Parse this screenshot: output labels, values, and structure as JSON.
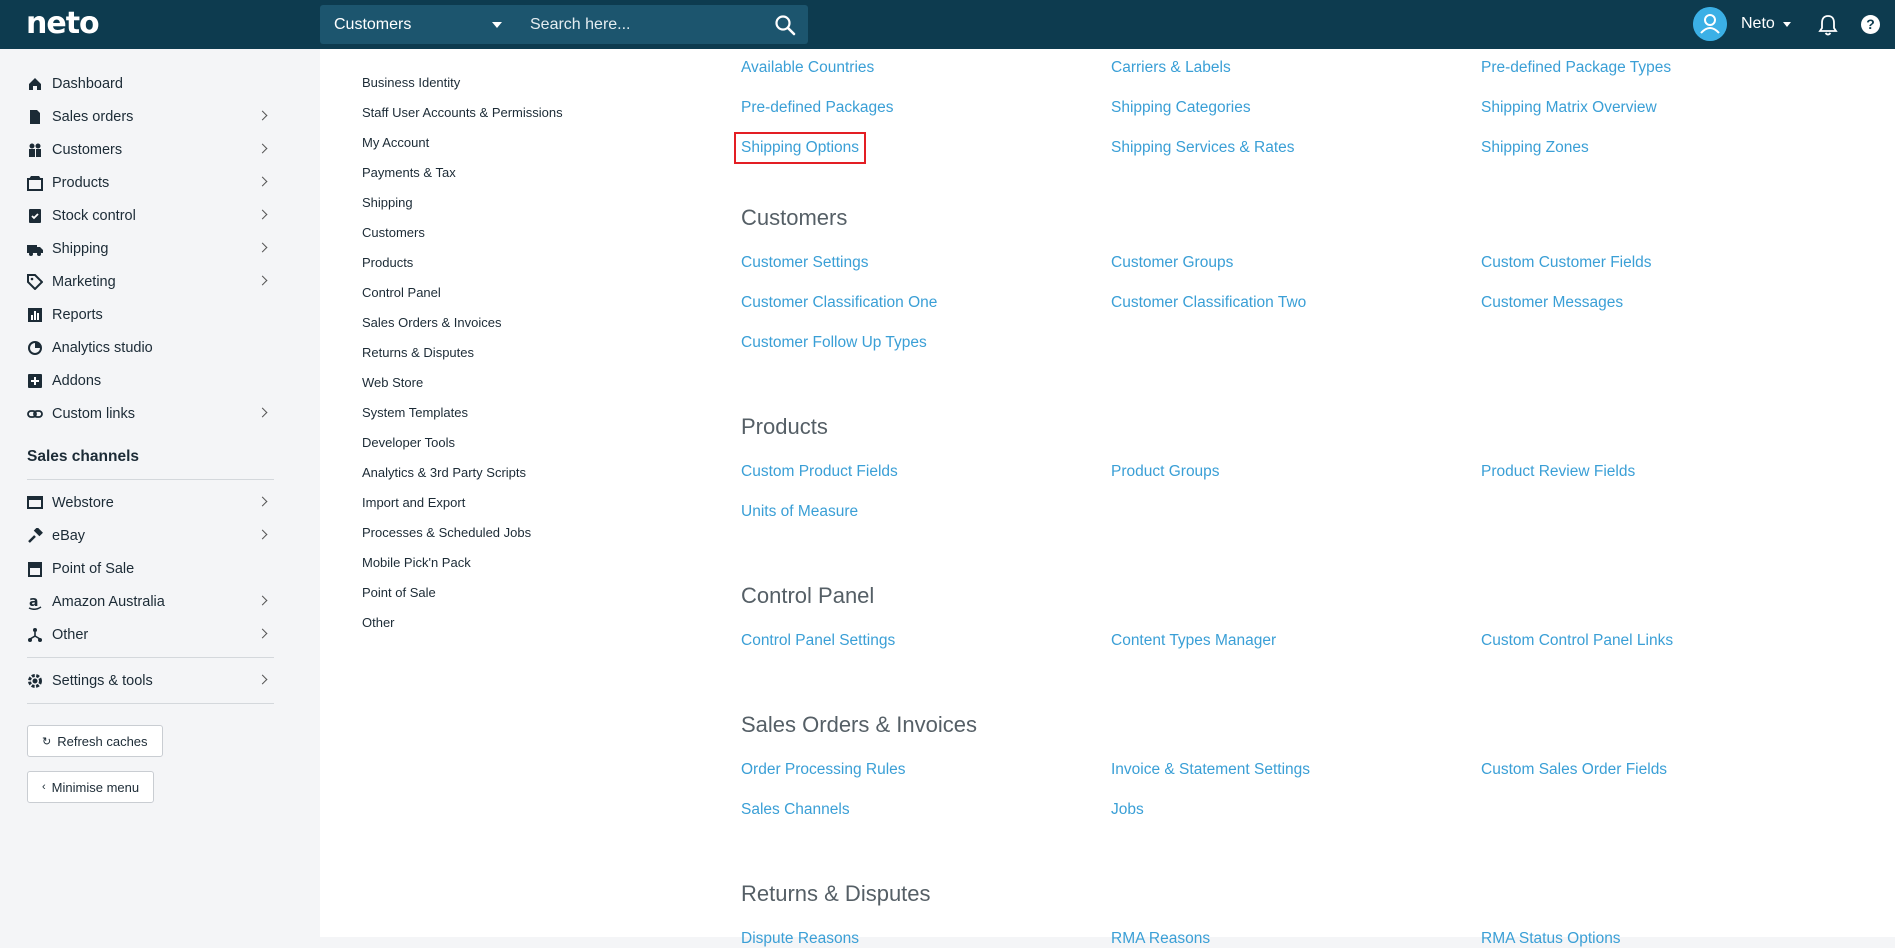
{
  "topbar": {
    "logo": "neto",
    "search_scope": "Customers",
    "search_placeholder": "Search here...",
    "user_name": "Neto",
    "help_label": "?"
  },
  "sidebar": {
    "items": [
      {
        "label": "Dashboard",
        "icon": "home-icon",
        "chevron": false
      },
      {
        "label": "Sales orders",
        "icon": "document-icon",
        "chevron": true
      },
      {
        "label": "Customers",
        "icon": "people-icon",
        "chevron": true
      },
      {
        "label": "Products",
        "icon": "box-icon",
        "chevron": true
      },
      {
        "label": "Stock control",
        "icon": "clipboard-check-icon",
        "chevron": true
      },
      {
        "label": "Shipping",
        "icon": "truck-icon",
        "chevron": true
      },
      {
        "label": "Marketing",
        "icon": "tag-icon",
        "chevron": true
      },
      {
        "label": "Reports",
        "icon": "bar-chart-icon",
        "chevron": false
      },
      {
        "label": "Analytics studio",
        "icon": "analytics-icon",
        "chevron": false
      },
      {
        "label": "Addons",
        "icon": "plus-square-icon",
        "chevron": false
      },
      {
        "label": "Custom links",
        "icon": "link-icon",
        "chevron": true
      }
    ],
    "channels_heading": "Sales channels",
    "channels": [
      {
        "label": "Webstore",
        "icon": "store-icon",
        "chevron": true
      },
      {
        "label": "eBay",
        "icon": "gavel-icon",
        "chevron": true
      },
      {
        "label": "Point of Sale",
        "icon": "shop-icon",
        "chevron": false
      },
      {
        "label": "Amazon Australia",
        "icon": "amazon-icon",
        "chevron": true
      },
      {
        "label": "Other",
        "icon": "network-icon",
        "chevron": true
      }
    ],
    "settings": {
      "label": "Settings & tools",
      "icon": "gear-icon"
    },
    "refresh_label": "Refresh caches",
    "minimise_label": "Minimise menu"
  },
  "subnav": [
    "Business Identity",
    "Staff User Accounts & Permissions",
    "My Account",
    "Payments & Tax",
    "Shipping",
    "Customers",
    "Products",
    "Control Panel",
    "Sales Orders & Invoices",
    "Returns & Disputes",
    "Web Store",
    "System Templates",
    "Developer Tools",
    "Analytics & 3rd Party Scripts",
    "Import and Export",
    "Processes & Scheduled Jobs",
    "Mobile Pick'n Pack",
    "Point of Sale",
    "Other"
  ],
  "shipping_links": [
    [
      "Available Countries",
      "Carriers & Labels",
      "Pre-defined Package Types"
    ],
    [
      "Pre-defined Packages",
      "Shipping Categories",
      "Shipping Matrix Overview"
    ],
    [
      "Shipping Options",
      "Shipping Services & Rates",
      "Shipping Zones"
    ]
  ],
  "sections": [
    {
      "title": "Customers",
      "rows": [
        [
          "Customer Settings",
          "Customer Groups",
          "Custom Customer Fields"
        ],
        [
          "Customer Classification One",
          "Customer Classification Two",
          "Customer Messages"
        ],
        [
          "Customer Follow Up Types",
          "",
          ""
        ]
      ]
    },
    {
      "title": "Products",
      "rows": [
        [
          "Custom Product Fields",
          "Product Groups",
          "Product Review Fields"
        ],
        [
          "Units of Measure",
          "",
          ""
        ]
      ]
    },
    {
      "title": "Control Panel",
      "rows": [
        [
          "Control Panel Settings",
          "Content Types Manager",
          "Custom Control Panel Links"
        ]
      ]
    },
    {
      "title": "Sales Orders & Invoices",
      "rows": [
        [
          "Order Processing Rules",
          "Invoice & Statement Settings",
          "Custom Sales Order Fields"
        ],
        [
          "Sales Channels",
          "Jobs",
          ""
        ]
      ]
    },
    {
      "title": "Returns & Disputes",
      "rows": [
        [
          "Dispute Reasons",
          "RMA Reasons",
          "RMA Status Options"
        ]
      ]
    }
  ],
  "colors": {
    "topbar": "#0d3b4f",
    "link": "#3a9fd6",
    "highlight": "#e31e24"
  }
}
